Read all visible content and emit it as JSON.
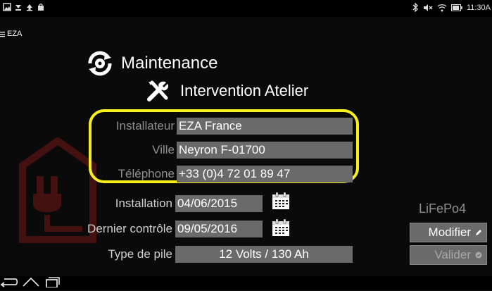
{
  "status": {
    "time": "11:30",
    "time_suffix": "A",
    "left_icons": [
      "image-icon",
      "download-icon",
      "upload-icon",
      "bag-icon"
    ],
    "right_icons": [
      "bluetooth-icon",
      "mute-icon",
      "wifi-icon",
      "battery-icon"
    ]
  },
  "appbar": {
    "title": "EZA"
  },
  "header": {
    "title": "Maintenance",
    "subtitle": "Intervention Atelier"
  },
  "fields": {
    "installateur": {
      "label": "Installateur",
      "value": "EZA France"
    },
    "ville": {
      "label": "Ville",
      "value": "Neyron F-01700"
    },
    "telephone": {
      "label": "Téléphone",
      "value": "+33 (0)4 72 01 89 47"
    },
    "installation": {
      "label": "Installation",
      "value": "04/06/2015"
    },
    "dernier_controle": {
      "label": "Dernier contrôle",
      "value": "09/05/2016"
    },
    "type_pile": {
      "label": "Type de pile",
      "value": "12 Volts / 130 Ah"
    }
  },
  "side": {
    "battery_type": "LiFePo4",
    "modify_label": "Modifier",
    "validate_label": "Valider"
  },
  "colors": {
    "highlight": "#f7ef1a",
    "field_bg": "#6a6a6a",
    "watermark": "#8b1a1a"
  }
}
